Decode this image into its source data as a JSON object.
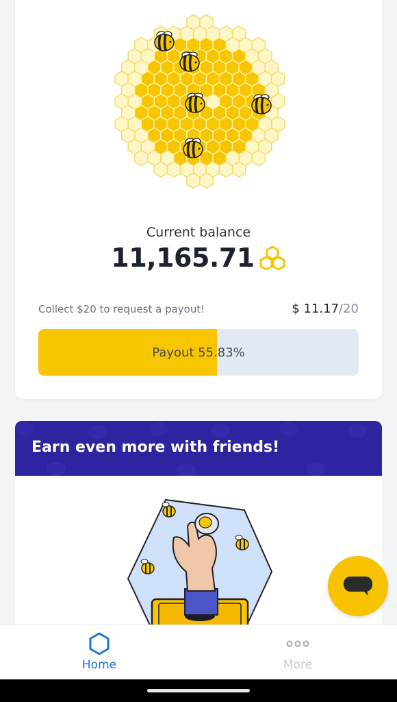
{
  "balance": {
    "label": "Current balance",
    "value": "11,165.71",
    "currency_icon": "honeycomb-icon"
  },
  "payout": {
    "text": "Collect $20 to request a payout!",
    "amount": "$ 11.17",
    "target": "/20",
    "progress_label": "Payout 55.83%",
    "progress": 0.5583
  },
  "friends": {
    "title": "Earn even more with friends!"
  },
  "nav": {
    "home_label": "Home",
    "more_label": "More"
  },
  "colors": {
    "accent_yellow": "#f7c600",
    "brand_purple": "#2e24a0",
    "active_blue": "#1976d2"
  }
}
